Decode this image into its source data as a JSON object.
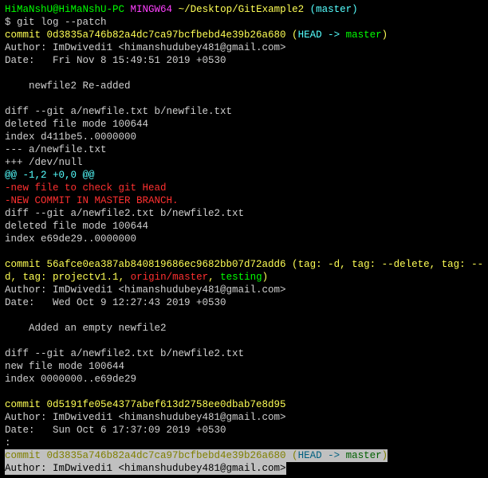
{
  "prompt": {
    "user_host": "HiMaNshU@HiMaNshU-PC",
    "shell": "MINGW64",
    "cwd": "~/Desktop/GitExample2",
    "branch": "(master)"
  },
  "command": "$ git log --patch",
  "commit1": {
    "line": "commit 0d3835a746b82a4dc7ca97bcfbebd4e39b26a680 (",
    "head": "HEAD -> ",
    "branch": "master",
    "close": ")",
    "author": "Author: ImDwivedi1 <himanshudubey481@gmail.com>",
    "date": "Date:   Fri Nov 8 15:49:51 2019 +0530",
    "msg": "    newfile2 Re-added"
  },
  "diff1": {
    "head": "diff --git a/newfile.txt b/newfile.txt",
    "del": "deleted file mode 100644",
    "idx": "index d411be5..0000000",
    "old": "--- a/newfile.txt",
    "new": "+++ /dev/null",
    "hunk": "@@ -1,2 +0,0 @@",
    "r1": "-new file to check git Head",
    "r2": "-NEW COMMIT IN MASTER BRANCH."
  },
  "diff2": {
    "head": "diff --git a/newfile2.txt b/newfile2.txt",
    "del": "deleted file mode 100644",
    "idx": "index e69de29..0000000"
  },
  "commit2": {
    "l1a": "commit 56afce0ea387ab840819686ec9682bb07d72add6 (",
    "l1b": "tag: -d",
    "l1c": ", ",
    "l1d": "tag: --delete",
    "l1e": ", ",
    "l1f": "tag: --",
    "l2a": "d",
    "l2b": ", ",
    "l2c": "tag: projectv1.1",
    "l2d": ", ",
    "l2e": "origin/master",
    "l2f": ", ",
    "l2g": "testing",
    "l2h": ")",
    "author": "Author: ImDwivedi1 <himanshudubey481@gmail.com>",
    "date": "Date:   Wed Oct 9 12:27:43 2019 +0530",
    "msg": "    Added an empty newfile2"
  },
  "diff3": {
    "head": "diff --git a/newfile2.txt b/newfile2.txt",
    "new": "new file mode 100644",
    "idx": "index 0000000..e69de29"
  },
  "commit3": {
    "line": "commit 0d5191fe05e4377abef613d2758ee0dbab7e8d95",
    "author": "Author: ImDwivedi1 <himanshudubey481@gmail.com>",
    "date": "Date:   Sun Oct 6 17:37:09 2019 +0530"
  },
  "pager": ":",
  "footer": {
    "line": "commit 0d3835a746b82a4dc7ca97bcfbebd4e39b26a680 (",
    "head": "HEAD -> ",
    "branch": "master",
    "close": ")",
    "author": "Author: ImDwivedi1 <himanshudubey481@gmail.com>"
  }
}
